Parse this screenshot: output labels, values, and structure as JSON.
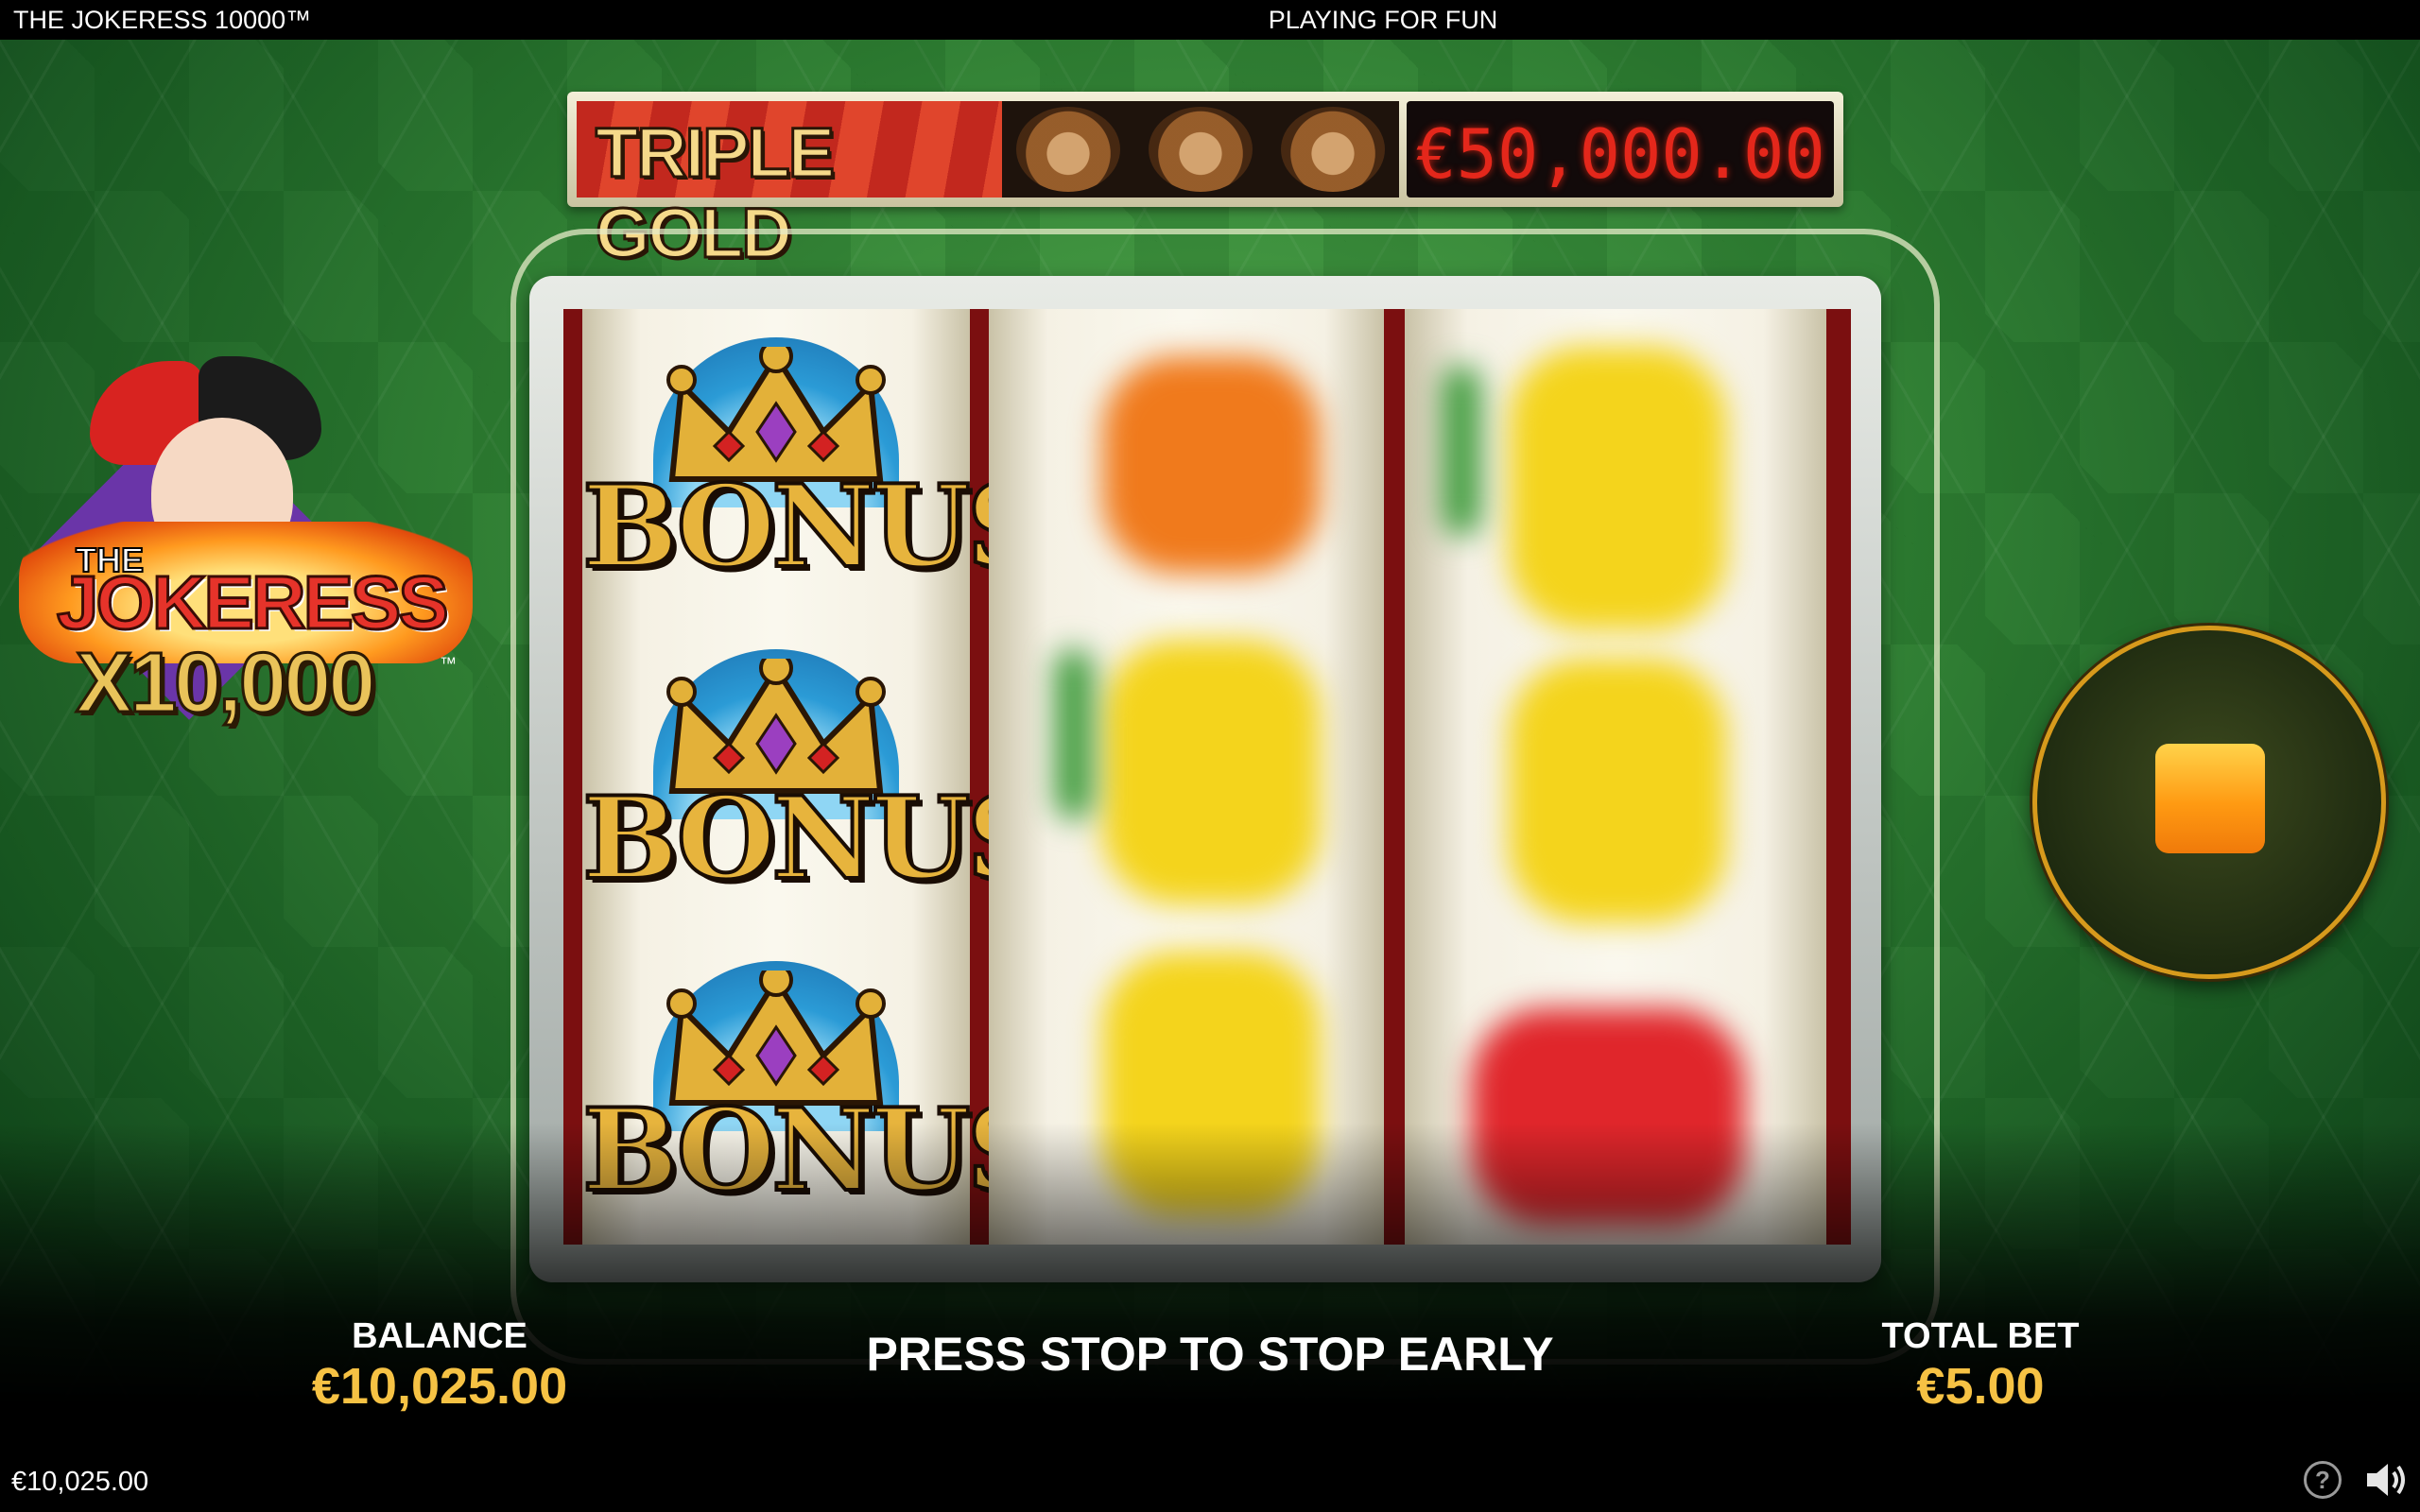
{
  "header": {
    "app_title": "THE JOKERESS 10000™",
    "mode_label": "PLAYING FOR FUN"
  },
  "jackpot": {
    "label": "TRIPLE GOLD",
    "amount": "€50,000.00",
    "jester_icon_count": 3
  },
  "logo": {
    "the": "THE",
    "name": "JOKERESS",
    "multiplier": "X10,000",
    "tm": "™"
  },
  "reels": {
    "reel_1": [
      "BONUS",
      "BONUS",
      "BONUS"
    ],
    "reel_2_state": "spinning",
    "reel_3_state": "spinning"
  },
  "controls": {
    "stop_button": "stop-icon"
  },
  "footer": {
    "balance_label": "BALANCE",
    "balance_value": "€10,025.00",
    "status_message": "PRESS STOP TO STOP EARLY",
    "total_bet_label": "TOTAL BET",
    "total_bet_value": "€5.00"
  },
  "bottombar": {
    "balance": "€10,025.00",
    "help_glyph": "?",
    "sound_icon": "speaker-icon"
  },
  "colors": {
    "accent_gold": "#f6c244",
    "jackpot_red": "#e4271b",
    "table_green": "#2f7d33",
    "stop_orange": "#ff9a12"
  }
}
